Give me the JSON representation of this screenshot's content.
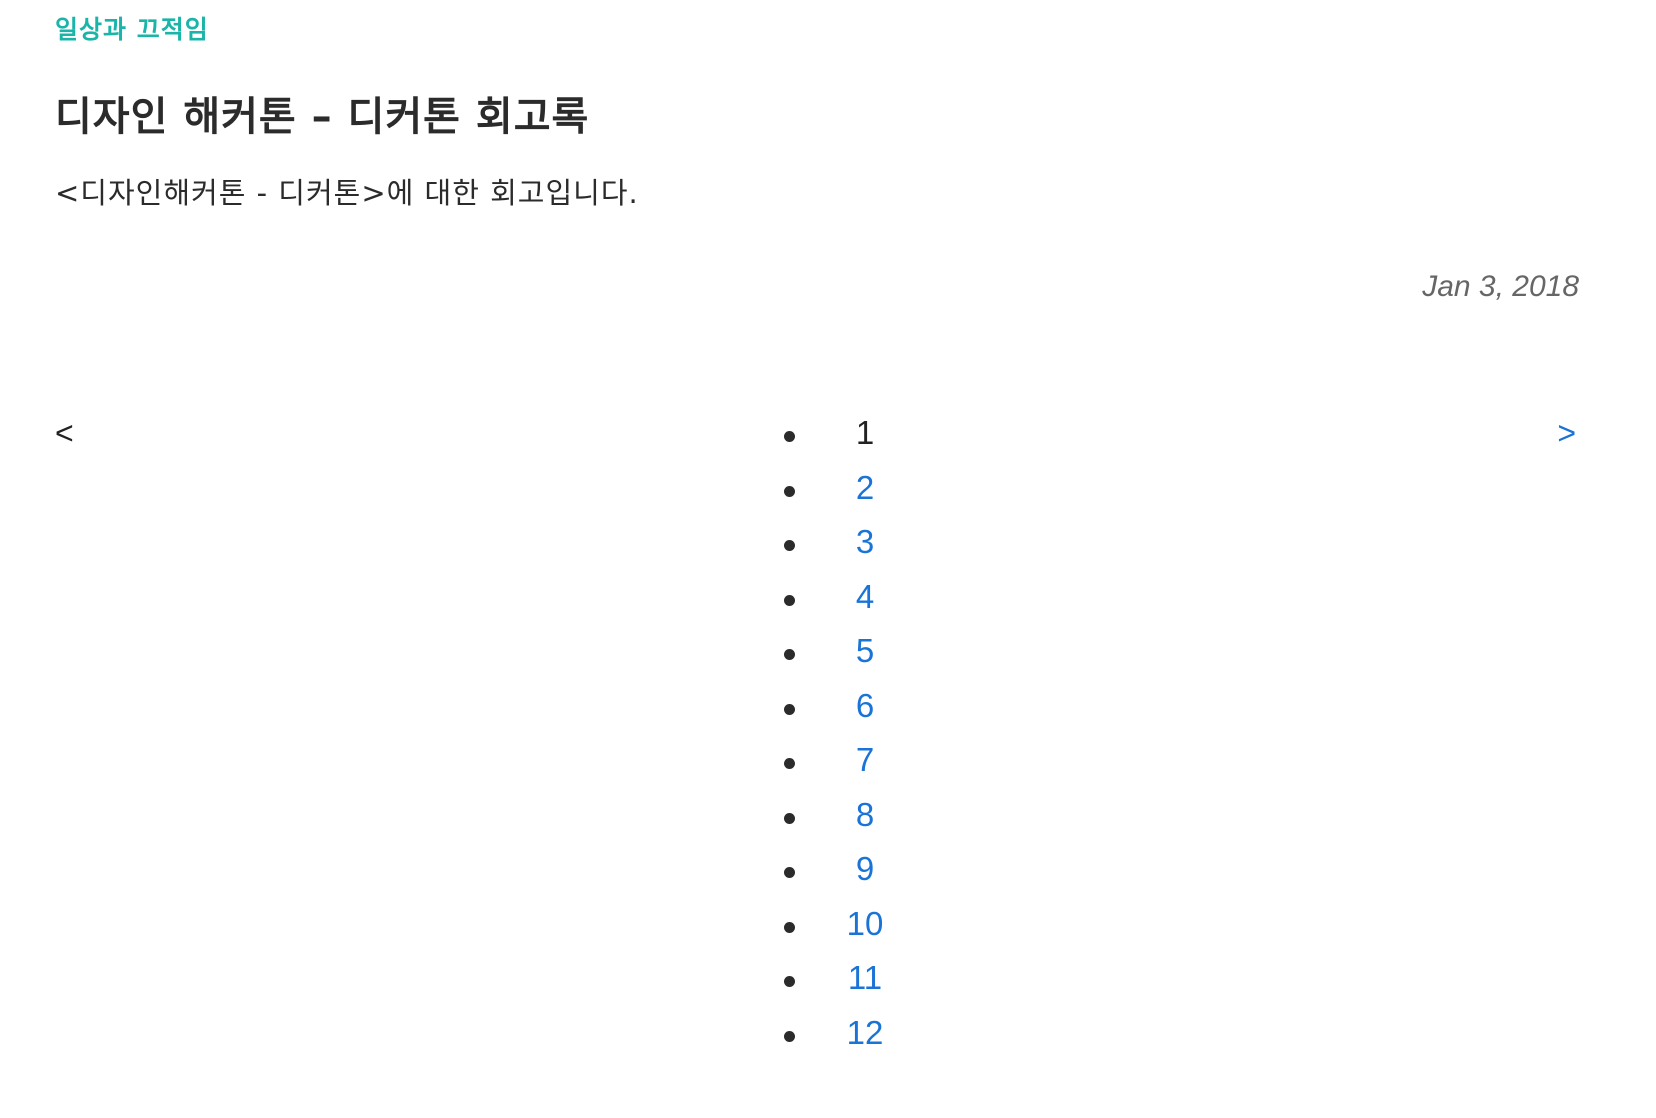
{
  "header": {
    "category": "일상과 끄적임"
  },
  "post": {
    "title": "디자인 해커톤 – 디커톤 회고록",
    "summary": "<디자인해커톤 - 디커톤>에 대한 회고입니다.",
    "date": "Jan 3, 2018"
  },
  "pagination": {
    "prev_label": "<",
    "next_label": ">",
    "current_page": "1",
    "pages": [
      "1",
      "2",
      "3",
      "4",
      "5",
      "6",
      "7",
      "8",
      "9",
      "10",
      "11",
      "12"
    ],
    "link_color": "#1a73d6",
    "current_color": "#222222"
  },
  "colors": {
    "category": "#1ab5a8",
    "text": "#2b2b2b",
    "date": "#666666"
  }
}
